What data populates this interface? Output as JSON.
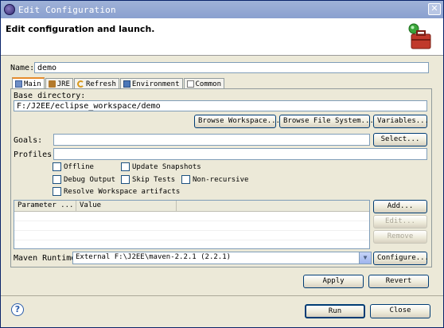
{
  "window": {
    "title": "Edit Configuration",
    "close_label": "✕"
  },
  "banner": {
    "heading": "Edit configuration and launch."
  },
  "name": {
    "label": "Name:",
    "value": "demo"
  },
  "tabs": [
    {
      "label": "Main",
      "active": true
    },
    {
      "label": "JRE",
      "active": false
    },
    {
      "label": "Refresh",
      "active": false
    },
    {
      "label": "Environment",
      "active": false
    },
    {
      "label": "Common",
      "active": false
    }
  ],
  "main": {
    "base_dir_label": "Base directory:",
    "base_dir_value": "F:/J2EE/eclipse_workspace/demo",
    "browse_workspace": "Browse Workspace...",
    "browse_filesystem": "Browse File System...",
    "variables": "Variables...",
    "goals_label": "Goals:",
    "goals_value": "",
    "select": "Select...",
    "profiles_label": "Profiles:",
    "profiles_value": "",
    "checkboxes": {
      "offline": "Offline",
      "update_snapshots": "Update Snapshots",
      "debug_output": "Debug Output",
      "skip_tests": "Skip Tests",
      "non_recursive": "Non-recursive",
      "resolve_workspace": "Resolve Workspace artifacts"
    },
    "table": {
      "col_parameter": "Parameter ...",
      "col_value": "Value"
    },
    "add": "Add...",
    "edit": "Edit...",
    "remove": "Remove",
    "runtime_label": "Maven Runtime:",
    "runtime_value": "External F:\\J2EE\\maven-2.2.1 (2.2.1)",
    "configure": "Configure..."
  },
  "footer": {
    "apply": "Apply",
    "revert": "Revert",
    "run": "Run",
    "close": "Close"
  }
}
